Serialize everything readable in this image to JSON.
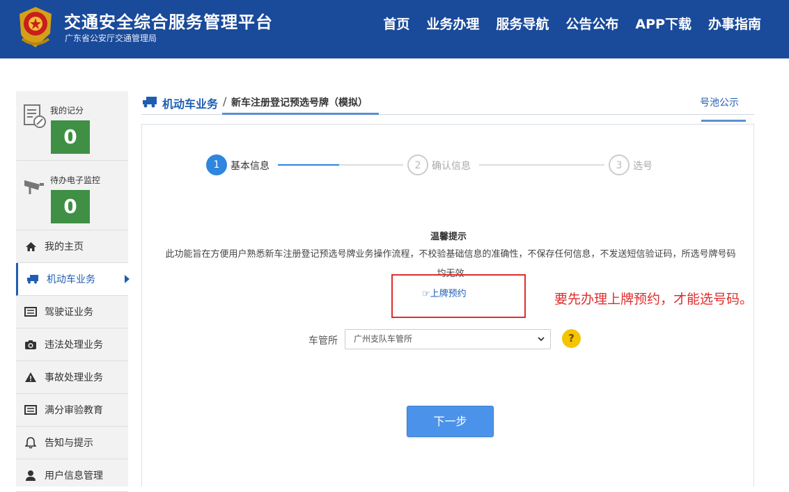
{
  "header": {
    "title": "交通安全综合服务管理平台",
    "subtitle": "广东省公安厅交通管理局",
    "nav": [
      "首页",
      "业务办理",
      "服务导航",
      "公告公布",
      "APP下载",
      "办事指南"
    ]
  },
  "sidebar": {
    "score": {
      "label": "我的记分",
      "value": "0"
    },
    "monitor": {
      "label": "待办电子监控",
      "value": "0"
    },
    "items": [
      {
        "label": "我的主页",
        "icon": "home-icon"
      },
      {
        "label": "机动车业务",
        "icon": "truck-icon",
        "active": true
      },
      {
        "label": "驾驶证业务",
        "icon": "card-icon"
      },
      {
        "label": "违法处理业务",
        "icon": "camera-icon"
      },
      {
        "label": "事故处理业务",
        "icon": "warning-icon"
      },
      {
        "label": "满分审验教育",
        "icon": "card-icon"
      },
      {
        "label": "告知与提示",
        "icon": "bell-icon"
      },
      {
        "label": "用户信息管理",
        "icon": "user-icon"
      }
    ]
  },
  "breadcrumb": {
    "section": "机动车业务",
    "separator": "/",
    "page": "新车注册登记预选号牌（模拟）",
    "pool_link": "号池公示"
  },
  "steps": [
    {
      "num": "1",
      "label": "基本信息"
    },
    {
      "num": "2",
      "label": "确认信息"
    },
    {
      "num": "3",
      "label": "选号"
    }
  ],
  "notice": {
    "title": "温馨提示",
    "text": "此功能旨在方便用户熟悉新车注册登记预选号牌业务操作流程，不校验基础信息的准确性，不保存任何信息，不发送短信验证码，所选号牌号码均无效",
    "link": "上牌预约"
  },
  "annotation": "要先办理上牌预约，才能选号码。",
  "form": {
    "office_label": "车管所",
    "office_value": "广州支队车管所",
    "help": "?"
  },
  "next_button": "下一步",
  "colors": {
    "header": "#1a4a9a",
    "accent": "#1f5db3",
    "score": "#3f8f45",
    "annotation": "#e02c2c"
  }
}
